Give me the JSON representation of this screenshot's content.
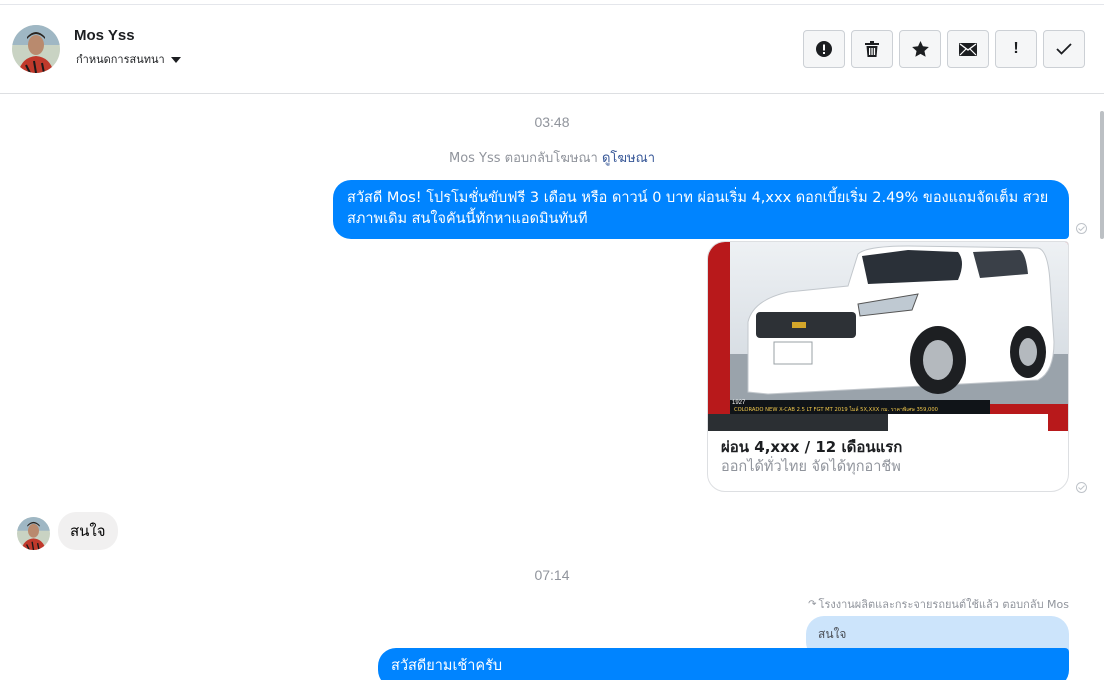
{
  "header": {
    "contact_name": "Mos Yss",
    "conversation_settings_label": "กำหนดการสนทนา",
    "actions": [
      {
        "name": "mark-spam-button",
        "icon": "alert-circle-icon"
      },
      {
        "name": "delete-button",
        "icon": "trash-icon"
      },
      {
        "name": "star-button",
        "icon": "star-icon"
      },
      {
        "name": "mark-unread-button",
        "icon": "envelope-icon"
      },
      {
        "name": "follow-up-button",
        "icon": "exclamation-icon",
        "glyph": "!"
      },
      {
        "name": "mark-done-button",
        "icon": "checkmark-icon"
      }
    ]
  },
  "thread": {
    "timestamp_1": "03:48",
    "ad_reply": {
      "text": "Mos Yss ตอบกลับโฆษณา",
      "link": "ดูโฆษณา"
    },
    "message_1": "สวัสดี Mos! โปรโมชั่นขับฟรี 3 เดือน หรือ ดาวน์ 0 บาท ผ่อนเริ่ม 4,xxx ดอกเบี้ยเริ่ม 2.49% ของแถมจัดเต็ม สวยสภาพเดิม สนใจคันนี้ทักหาแอดมินทันที",
    "card": {
      "image_caption": "COLORADO NEW X-CAB 2.5 LT FGT MT 2019 ไมล์ 5X,XXX กม. ราคาพิเศษ 359,000",
      "image_code": "1927",
      "title": "ผ่อน 4,xxx / 12 เดือนแรก",
      "subtitle": "ออกได้ทั่วไทย จัดได้ทุกอาชีพ"
    },
    "incoming_message": "สนใจ",
    "timestamp_2": "07:14",
    "reply_note": "โรงงานผลิตและกระจายรถยนต์ใช้แล้ว ตอบกลับ Mos",
    "quoted_message": "สนใจ",
    "message_3": "สวัสดียามเช้าครับ"
  },
  "colors": {
    "outgoing_bubble": "#0084ff",
    "incoming_bubble": "#f1f0f0",
    "quoted_bubble": "#cce4fb",
    "link": "#385898"
  }
}
